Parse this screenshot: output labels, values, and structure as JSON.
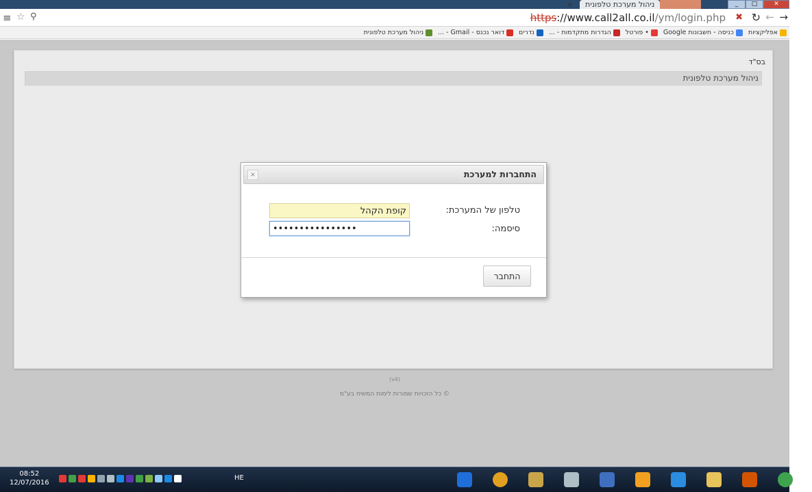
{
  "browser": {
    "tab_title": "ניהול מערכת טלפונית",
    "tab_close": "×",
    "window_buttons": [
      "_",
      "□",
      "✕"
    ],
    "url_scheme": "https",
    "url_host": "://www.call2all.co.il",
    "url_path": "/ym/login.php"
  },
  "bookmarks": [
    {
      "label": "אפליקציות",
      "color": "#f4b400"
    },
    {
      "label": "כניסה - חשבונות Google",
      "color": "#4285f4"
    },
    {
      "label": "• פורטל",
      "color": "#e53935"
    },
    {
      "label": "הגדרות מתקדמות - ...",
      "color": "#c62828"
    },
    {
      "label": "נדרים",
      "color": "#1565c0"
    },
    {
      "label": "דואר נכנס - Gmail - ...",
      "color": "#d93025"
    },
    {
      "label": "ניהול מערכת טלפונית",
      "color": "#5f8f2f"
    }
  ],
  "page": {
    "bsd": "בס\"ד",
    "header_title": "ניהול מערכת טלפונית",
    "footer_small": "(v4)",
    "footer_copyright": "© כל הזכויות שמורות לימות המשיח בע\"מ"
  },
  "dialog": {
    "title": "התחברות למערכת",
    "close_glyph": "×",
    "phone_label": "טלפון של המערכת:",
    "phone_value": "קופת הקהל",
    "password_label": "סיסמה:",
    "password_value": "••••••••••••••••",
    "submit_label": "התחבר"
  },
  "taskbar": {
    "time": "08:52",
    "date": "12/07/2016",
    "language": "HE",
    "tray_colors": [
      "#e53935",
      "#43a047",
      "#e53935",
      "#ffb300",
      "#90a4ae",
      "#b0bec5",
      "#1e88e5",
      "#5e35b1",
      "#43a047",
      "#7cb342",
      "#90caf9",
      "#1e88e5",
      "#ffffff"
    ],
    "apps": [
      {
        "name": "teamviewer",
        "color": "#1e6fd9"
      },
      {
        "name": "chrome",
        "color": "#e0a020"
      },
      {
        "name": "explorer",
        "color": "#c9a54a"
      },
      {
        "name": "fax",
        "color": "#b0bec5"
      },
      {
        "name": "media",
        "color": "#3f6fbf"
      },
      {
        "name": "outlook",
        "color": "#f2a020"
      },
      {
        "name": "ie",
        "color": "#2a8de0"
      },
      {
        "name": "folder",
        "color": "#e8c25a"
      },
      {
        "name": "tray-app",
        "color": "#d35400"
      },
      {
        "name": "start-orb",
        "color": "#3fa34d"
      }
    ]
  }
}
